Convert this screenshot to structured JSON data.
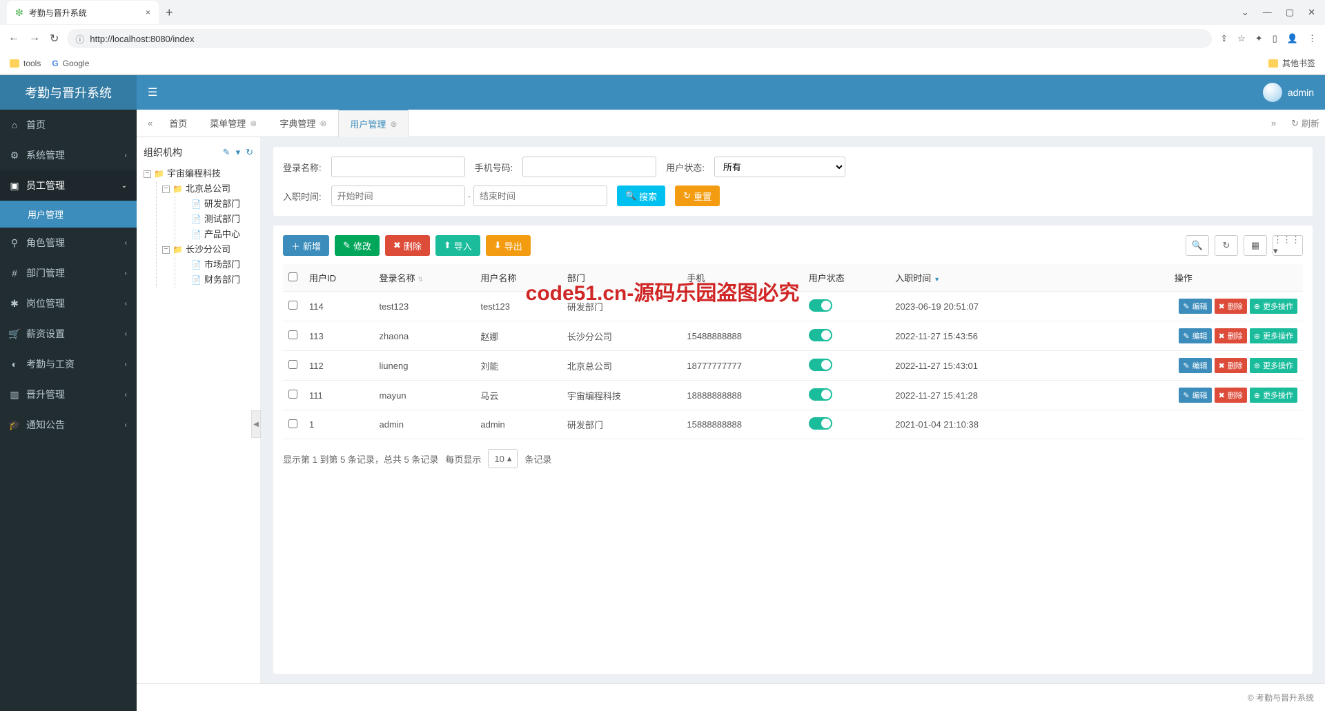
{
  "browser": {
    "tab_title": "考勤与晋升系统",
    "new_tab": "+",
    "url": "http://localhost:8080/index",
    "bookmarks": {
      "tools": "tools",
      "google": "Google",
      "other": "其他书签"
    }
  },
  "app": {
    "brand": "考勤与晋升系统",
    "user": "admin",
    "footer": "© 考勤与晋升系统"
  },
  "sidebar": {
    "items": [
      {
        "icon": "⌂",
        "label": "首页",
        "chev": ""
      },
      {
        "icon": "⚙",
        "label": "系统管理",
        "chev": "‹"
      },
      {
        "icon": "▣",
        "label": "员工管理",
        "chev": "⌄",
        "active": true
      },
      {
        "icon": "⚲",
        "label": "角色管理",
        "chev": "‹"
      },
      {
        "icon": "#",
        "label": "部门管理",
        "chev": "‹"
      },
      {
        "icon": "✱",
        "label": "岗位管理",
        "chev": "‹"
      },
      {
        "icon": "🛒",
        "label": "薪资设置",
        "chev": "‹"
      },
      {
        "icon": "◐",
        "label": "考勤与工资",
        "chev": "‹"
      },
      {
        "icon": "▥",
        "label": "晋升管理",
        "chev": "‹"
      },
      {
        "icon": "🎓",
        "label": "通知公告",
        "chev": "‹"
      }
    ],
    "submenu": {
      "label": "用户管理"
    }
  },
  "tabs": {
    "arrow_left": "«",
    "arrow_right": "»",
    "refresh_icon": "↻",
    "refresh_label": "刷新",
    "items": [
      {
        "label": "首页",
        "closable": false,
        "active": false
      },
      {
        "label": "菜单管理",
        "closable": true,
        "active": false
      },
      {
        "label": "字典管理",
        "closable": true,
        "active": false
      },
      {
        "label": "用户管理",
        "closable": true,
        "active": true
      }
    ]
  },
  "org": {
    "title": "组织机构",
    "edit_icon": "✎",
    "caret_icon": "▾",
    "refresh_icon": "↻",
    "tree": {
      "root": {
        "label": "宇宙编程科技"
      },
      "children": [
        {
          "label": "北京总公司",
          "children": [
            {
              "label": "研发部门"
            },
            {
              "label": "测试部门"
            },
            {
              "label": "产品中心"
            }
          ]
        },
        {
          "label": "长沙分公司",
          "children": [
            {
              "label": "市场部门"
            },
            {
              "label": "财务部门"
            }
          ]
        }
      ]
    }
  },
  "filters": {
    "login_name_label": "登录名称:",
    "phone_label": "手机号码:",
    "status_label": "用户状态:",
    "status_value": "所有",
    "hire_label": "入职时间:",
    "start_placeholder": "开始时间",
    "end_placeholder": "结束时间",
    "search_btn": "搜索",
    "reset_btn": "重置"
  },
  "toolbar": {
    "add": "新增",
    "edit": "修改",
    "delete": "删除",
    "import": "导入",
    "export": "导出"
  },
  "table": {
    "headers": {
      "user_id": "用户ID",
      "login_name": "登录名称",
      "user_name": "用户名称",
      "dept": "部门",
      "phone": "手机",
      "status": "用户状态",
      "hire_time": "入职时间",
      "ops": "操作"
    },
    "ops": {
      "edit": "编辑",
      "delete": "删除",
      "more": "更多操作"
    },
    "rows": [
      {
        "user_id": "114",
        "login_name": "test123",
        "user_name": "test123",
        "dept": "研发部门",
        "phone": "",
        "hire_time": "2023-06-19 20:51:07",
        "show_ops": true
      },
      {
        "user_id": "113",
        "login_name": "zhaona",
        "user_name": "赵娜",
        "dept": "长沙分公司",
        "phone": "15488888888",
        "hire_time": "2022-11-27 15:43:56",
        "show_ops": true
      },
      {
        "user_id": "112",
        "login_name": "liuneng",
        "user_name": "刘能",
        "dept": "北京总公司",
        "phone": "18777777777",
        "hire_time": "2022-11-27 15:43:01",
        "show_ops": true
      },
      {
        "user_id": "111",
        "login_name": "mayun",
        "user_name": "马云",
        "dept": "宇宙编程科技",
        "phone": "18888888888",
        "hire_time": "2022-11-27 15:41:28",
        "show_ops": true
      },
      {
        "user_id": "1",
        "login_name": "admin",
        "user_name": "admin",
        "dept": "研发部门",
        "phone": "15888888888",
        "hire_time": "2021-01-04 21:10:38",
        "show_ops": false
      }
    ]
  },
  "pager": {
    "info_pre": "显示第 1 到第 5 条记录，总共 5 条记录",
    "per_page_label_pre": "每页显示",
    "per_page_value": "10",
    "per_page_label_post": "条记录"
  },
  "watermark": {
    "center": "code51.cn-源码乐园盗图必究"
  }
}
